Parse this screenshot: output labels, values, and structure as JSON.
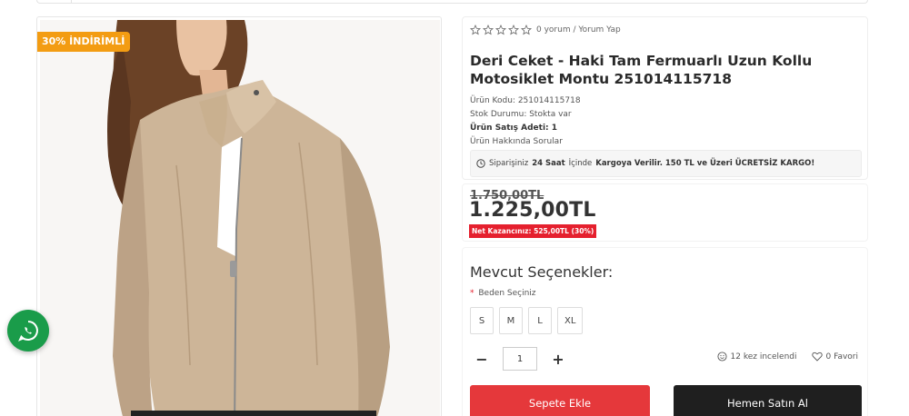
{
  "badge": {
    "discount": "30% İNDİRİMLİ"
  },
  "rating": {
    "review_text": "0 yorum / Yorum Yap",
    "stars": 0,
    "max_stars": 5
  },
  "product": {
    "title": "Deri Ceket - Haki Tam Fermuarlı Uzun Kollu Motosiklet Montu 251014115718",
    "code": "Ürün Kodu: 251014115718",
    "stock": "Stok Durumu: Stokta var",
    "sales": "Ürün Satış Adeti: 1",
    "questions": "Ürün Hakkında Sorular"
  },
  "shipping": {
    "p1": "Siparişiniz",
    "hours": "24 Saat",
    "p2": "İçinde",
    "cargo": "Kargoya Verilir. 150 TL ve Üzeri ÜCRETSİZ KARGO!"
  },
  "price": {
    "old": "1.750,00TL",
    "new": "1.225,00TL",
    "net_gain": "Net Kazancınız: 525,00TL (30%)"
  },
  "options": {
    "title": "Mevcut Seçenekler:",
    "size_label": "Beden Seçiniz",
    "required_mark": "*",
    "sizes": [
      "S",
      "M",
      "L",
      "XL"
    ]
  },
  "quantity": {
    "value": "1",
    "minus": "−",
    "plus": "+"
  },
  "stats": {
    "views": "12 kez incelendi",
    "favorites": "0 Favori"
  },
  "actions": {
    "add_to_cart": "Sepete Ekle",
    "buy_now": "Hemen Satın Al"
  },
  "colors": {
    "accent_red": "#e5383b",
    "badge_orange": "#f39c12",
    "whatsapp_green": "#1a9c4a",
    "dark_button": "#1f1f1f"
  }
}
